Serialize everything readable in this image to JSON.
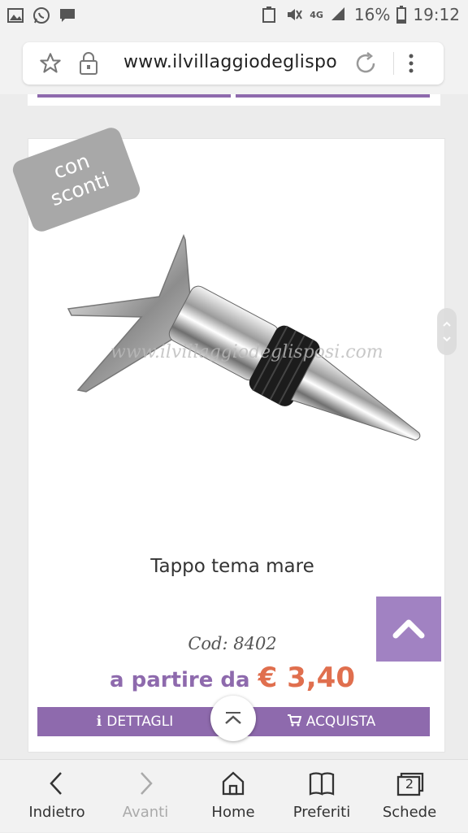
{
  "status_bar": {
    "battery": "16%",
    "time": "19:12",
    "network": "4G",
    "icons": [
      "image-icon",
      "whatsapp-icon",
      "message-icon",
      "nfc-icon",
      "mute-icon",
      "signal-icon",
      "battery-icon"
    ]
  },
  "browser": {
    "url": "www.ilvillaggiodeglispo"
  },
  "product": {
    "badge_line1": "con",
    "badge_line2": "sconti",
    "watermark": "www.ilvillaggiodeglisposi.com",
    "title": "Tappo tema mare",
    "code": "Cod: 8402",
    "price_prefix": "a partire da",
    "price": "€ 3,40",
    "details_label": "DETTAGLI",
    "buy_label": "ACQUISTA"
  },
  "colors": {
    "accent": "#8e6aad",
    "scroll_top": "#a182c2",
    "price": "#e06f4e",
    "badge": "#a8a8a8"
  },
  "bottom_nav": {
    "back": "Indietro",
    "forward": "Avanti",
    "home": "Home",
    "bookmarks": "Preferiti",
    "tabs": "Schede",
    "tab_count": "2"
  }
}
